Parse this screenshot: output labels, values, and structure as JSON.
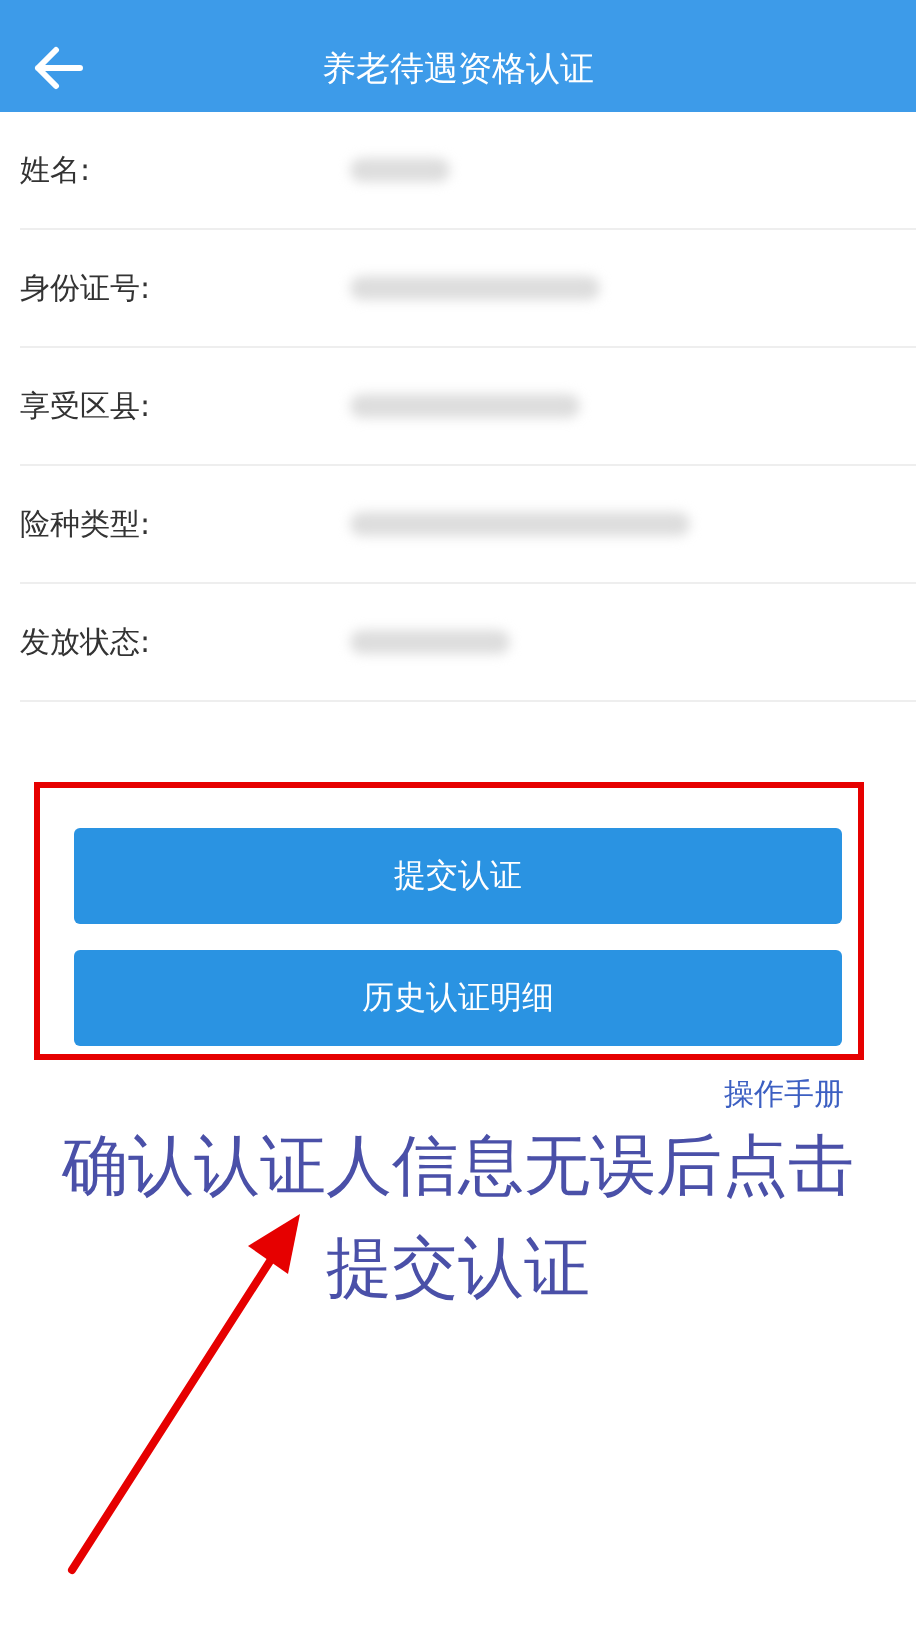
{
  "header": {
    "title": "养老待遇资格认证"
  },
  "fields": [
    {
      "label": "姓名:"
    },
    {
      "label": "身份证号:"
    },
    {
      "label": "享受区县:"
    },
    {
      "label": "险种类型:"
    },
    {
      "label": "发放状态:"
    }
  ],
  "buttons": [
    "提交认证",
    "历史认证明细"
  ],
  "manual_link": "操作手册",
  "annotation": {
    "line_1": "确认认证人信息无误后点击",
    "line_2": "提交认证"
  }
}
